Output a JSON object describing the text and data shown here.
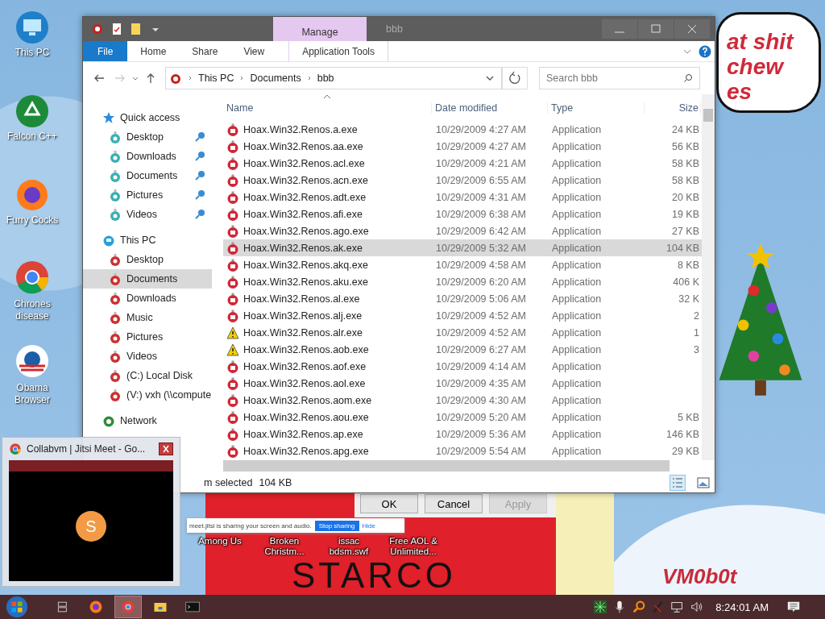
{
  "desktop": {
    "icons": [
      {
        "label": "This PC",
        "kind": "pc"
      },
      {
        "label": "Falcon C++",
        "kind": "recycle"
      },
      {
        "label": "Furry Cocks",
        "kind": "firefox"
      },
      {
        "label": "Chrones disease",
        "kind": "chrome"
      },
      {
        "label": "Obama Browser",
        "kind": "obama"
      }
    ],
    "bottom_icons": [
      {
        "label": "Among Us"
      },
      {
        "label": "Broken Christm..."
      },
      {
        "label": "issac bdsm.swf"
      },
      {
        "label": "Free AOL & Unlimited..."
      }
    ],
    "bubble_lines": [
      "at shit",
      "chew",
      "es"
    ],
    "poster_text": "STARCO",
    "signature": "VM0b0t"
  },
  "explorer": {
    "title": "bbb",
    "context_tab": "Manage",
    "ribbon_tabs": [
      {
        "label": "File",
        "kind": "file",
        "selected": false
      },
      {
        "label": "Home",
        "kind": "tab",
        "selected": false
      },
      {
        "label": "Share",
        "kind": "tab",
        "selected": false
      },
      {
        "label": "View",
        "kind": "tab",
        "selected": false
      },
      {
        "label": "Application Tools",
        "kind": "context",
        "selected": false
      }
    ],
    "breadcrumb": [
      "This PC",
      "Documents",
      "bbb"
    ],
    "search": {
      "placeholder": "Search bbb"
    },
    "nav": [
      {
        "label": "Quick access",
        "kind": "star",
        "selected": false,
        "children": [
          {
            "label": "Desktop",
            "pinned": true,
            "selected": false
          },
          {
            "label": "Downloads",
            "pinned": true,
            "selected": false
          },
          {
            "label": "Documents",
            "pinned": true,
            "selected": false
          },
          {
            "label": "Pictures",
            "pinned": true,
            "selected": false
          },
          {
            "label": "Videos",
            "pinned": true,
            "selected": false
          }
        ]
      },
      {
        "label": "This PC",
        "kind": "pc",
        "selected": false,
        "children": [
          {
            "label": "Desktop",
            "pinned": false,
            "selected": false
          },
          {
            "label": "Documents",
            "pinned": false,
            "selected": true
          },
          {
            "label": "Downloads",
            "pinned": false,
            "selected": false
          },
          {
            "label": "Music",
            "pinned": false,
            "selected": false
          },
          {
            "label": "Pictures",
            "pinned": false,
            "selected": false
          },
          {
            "label": "Videos",
            "pinned": false,
            "selected": false
          },
          {
            "label": "(C:) Local Disk",
            "pinned": false,
            "selected": false
          },
          {
            "label": "(V:) vxh (\\\\compute",
            "pinned": false,
            "selected": false
          }
        ]
      },
      {
        "label": "Network",
        "kind": "globe",
        "selected": false
      }
    ],
    "columns": [
      "Name",
      "Date modified",
      "Type",
      "Size"
    ],
    "rows": [
      {
        "name": "Hoax.Win32.Renos.a.exe",
        "date": "10/29/2009 4:27 AM",
        "type": "Application",
        "size": "24 KB",
        "kind": "app",
        "selected": false
      },
      {
        "name": "Hoax.Win32.Renos.aa.exe",
        "date": "10/29/2009 4:27 AM",
        "type": "Application",
        "size": "56 KB",
        "kind": "app",
        "selected": false
      },
      {
        "name": "Hoax.Win32.Renos.acl.exe",
        "date": "10/29/2009 4:21 AM",
        "type": "Application",
        "size": "58 KB",
        "kind": "app",
        "selected": false
      },
      {
        "name": "Hoax.Win32.Renos.acn.exe",
        "date": "10/29/2009 6:55 AM",
        "type": "Application",
        "size": "58 KB",
        "kind": "app",
        "selected": false
      },
      {
        "name": "Hoax.Win32.Renos.adt.exe",
        "date": "10/29/2009 4:31 AM",
        "type": "Application",
        "size": "20 KB",
        "kind": "app",
        "selected": false
      },
      {
        "name": "Hoax.Win32.Renos.afi.exe",
        "date": "10/29/2009 6:38 AM",
        "type": "Application",
        "size": "19 KB",
        "kind": "app",
        "selected": false
      },
      {
        "name": "Hoax.Win32.Renos.ago.exe",
        "date": "10/29/2009 6:42 AM",
        "type": "Application",
        "size": "27 KB",
        "kind": "app",
        "selected": false
      },
      {
        "name": "Hoax.Win32.Renos.ak.exe",
        "date": "10/29/2009 5:32 AM",
        "type": "Application",
        "size": "104 KB",
        "kind": "app",
        "selected": true
      },
      {
        "name": "Hoax.Win32.Renos.akq.exe",
        "date": "10/29/2009 4:58 AM",
        "type": "Application",
        "size": "8 KB",
        "kind": "app",
        "selected": false
      },
      {
        "name": "Hoax.Win32.Renos.aku.exe",
        "date": "10/29/2009 6:20 AM",
        "type": "Application",
        "size": "406 K",
        "kind": "app",
        "selected": false
      },
      {
        "name": "Hoax.Win32.Renos.al.exe",
        "date": "10/29/2009 5:06 AM",
        "type": "Application",
        "size": "32 K",
        "kind": "app",
        "selected": false
      },
      {
        "name": "Hoax.Win32.Renos.alj.exe",
        "date": "10/29/2009 4:52 AM",
        "type": "Application",
        "size": "2",
        "kind": "app",
        "selected": false
      },
      {
        "name": "Hoax.Win32.Renos.alr.exe",
        "date": "10/29/2009 4:52 AM",
        "type": "Application",
        "size": "1",
        "kind": "warning",
        "selected": false
      },
      {
        "name": "Hoax.Win32.Renos.aob.exe",
        "date": "10/29/2009 6:27 AM",
        "type": "Application",
        "size": "3",
        "kind": "warning",
        "selected": false
      },
      {
        "name": "Hoax.Win32.Renos.aof.exe",
        "date": "10/29/2009 4:14 AM",
        "type": "Application",
        "kind": "app",
        "selected": false
      },
      {
        "name": "Hoax.Win32.Renos.aol.exe",
        "date": "10/29/2009 4:35 AM",
        "type": "Application",
        "kind": "app",
        "selected": false
      },
      {
        "name": "Hoax.Win32.Renos.aom.exe",
        "date": "10/29/2009 4:30 AM",
        "type": "Application",
        "kind": "app",
        "selected": false
      },
      {
        "name": "Hoax.Win32.Renos.aou.exe",
        "date": "10/29/2009 5:20 AM",
        "type": "Application",
        "size": "5 KB",
        "kind": "app",
        "selected": false
      },
      {
        "name": "Hoax.Win32.Renos.ap.exe",
        "date": "10/29/2009 5:36 AM",
        "type": "Application",
        "size": "146 KB",
        "kind": "app",
        "selected": false
      },
      {
        "name": "Hoax.Win32.Renos.apg.exe",
        "date": "10/29/2009 5:54 AM",
        "type": "Application",
        "size": "29 KB",
        "kind": "app",
        "selected": false
      }
    ],
    "status": [
      "m selected",
      "104 KB"
    ]
  },
  "dialog_buttons": [
    {
      "label": "OK",
      "disabled": false
    },
    {
      "label": "Cancel",
      "disabled": false
    },
    {
      "label": "Apply",
      "disabled": true
    }
  ],
  "share_bar": {
    "message": "meet.jitsi is sharing your screen and audio.",
    "stop": "Stop sharing",
    "hide": "Hide"
  },
  "thumbnail": {
    "title": "Collabvm | Jitsi Meet - Go...",
    "avatar": "S"
  },
  "taskbar": {
    "apps": [
      {
        "kind": "taskview",
        "active": false
      },
      {
        "kind": "firefox",
        "active": false
      },
      {
        "kind": "chrome",
        "active": true
      },
      {
        "kind": "folder",
        "active": false
      },
      {
        "kind": "cmd",
        "active": false
      }
    ],
    "clock": "8:24:01 AM"
  }
}
